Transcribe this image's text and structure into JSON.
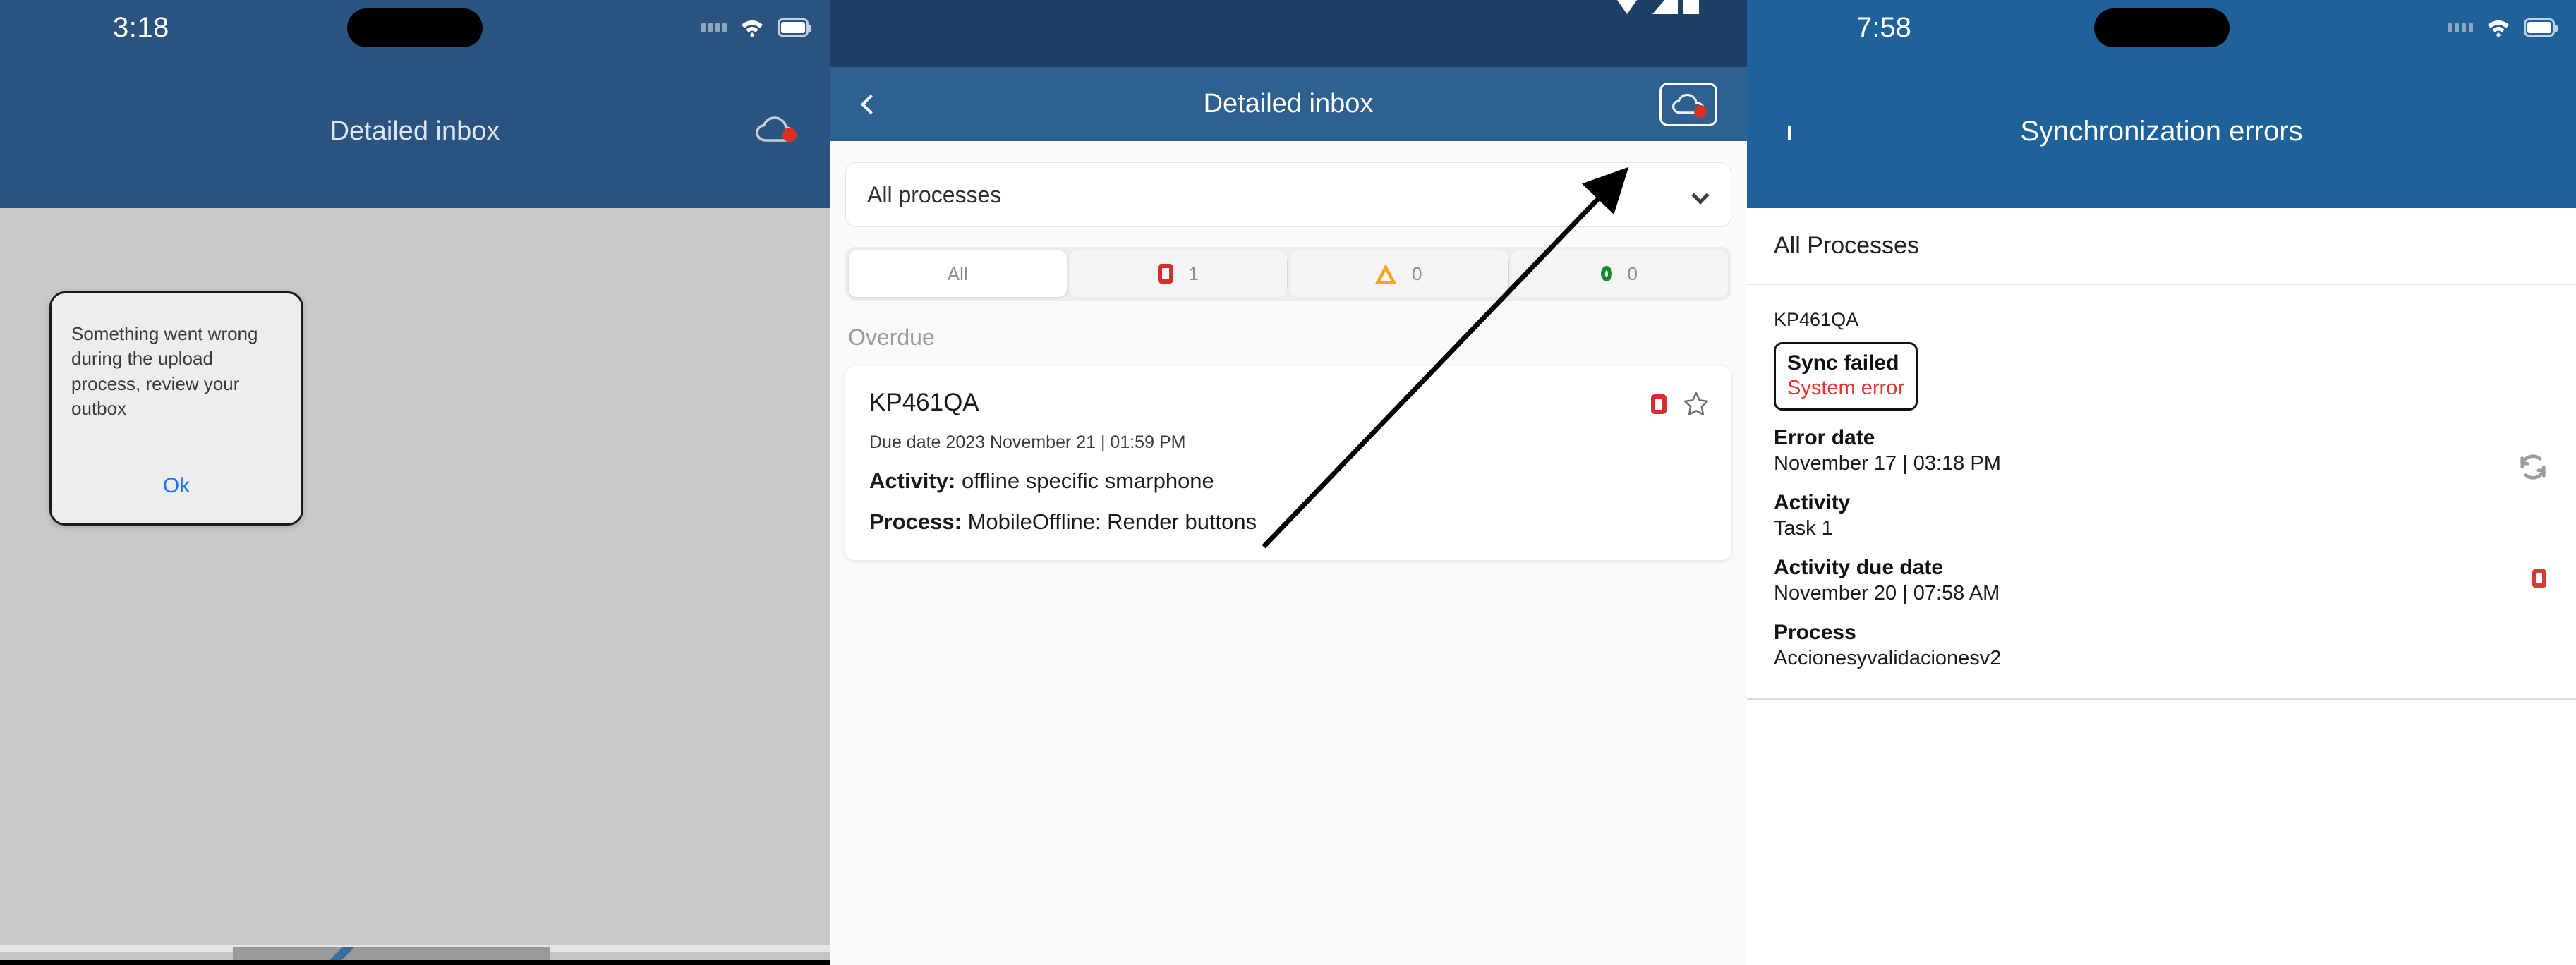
{
  "panel1": {
    "status_bar": {
      "time": "3:18",
      "icons": [
        "dots-icon",
        "wifi-icon",
        "battery-icon"
      ]
    },
    "title": "Detailed inbox",
    "cloud_button": {
      "icon": "cloud-icon",
      "badge_color": "#d93025"
    },
    "dialog": {
      "message": "Something went wrong during the upload process, review your outbox",
      "ok_label": "Ok",
      "ok_color": "#1f6fef"
    }
  },
  "panel2": {
    "status_bar": {
      "icons": [
        "triangle-down-icon",
        "signal-icon",
        "battery-icon"
      ]
    },
    "title": "Detailed inbox",
    "back_label": "",
    "cloud_button": {
      "icon": "cloud-icon",
      "badge_color": "#d93025",
      "highlighted": true
    },
    "process_select": {
      "value": "All processes",
      "chevron": "chevron-down-icon"
    },
    "segments": [
      {
        "label": "All",
        "icon": "",
        "count": "",
        "active": true
      },
      {
        "label": "",
        "icon": "square-red-icon",
        "count": "1",
        "active": false
      },
      {
        "label": "",
        "icon": "triangle-amber-icon",
        "count": "0",
        "active": false
      },
      {
        "label": "",
        "icon": "circle-green-icon",
        "count": "0",
        "active": false
      }
    ],
    "section_label": "Overdue",
    "card": {
      "title": "KP461QA",
      "due_date": "Due date 2023 November 21 | 01:59 PM",
      "activity_label": "Activity:",
      "activity_value": "offline specific smarphone",
      "process_label": "Process:",
      "process_value": "MobileOffline: Render buttons",
      "status_icon": "square-red-icon",
      "favorite_icon": "star-outline-icon"
    }
  },
  "panel3": {
    "status_bar": {
      "time": "7:58",
      "icons": [
        "dots-icon",
        "wifi-icon",
        "battery-icon"
      ]
    },
    "title": "Synchronization errors",
    "list_header": "All Processes",
    "item": {
      "id": "KP461QA",
      "badge_title": "Sync failed",
      "badge_subtitle": "System error",
      "badge_subtitle_color": "#e8342f",
      "fields": [
        {
          "label": "Error date",
          "value": "November 17 | 03:18 PM"
        },
        {
          "label": "Activity",
          "value": "Task 1"
        },
        {
          "label": "Activity due date",
          "value": "November 20 | 07:58 AM"
        },
        {
          "label": "Process",
          "value": "Accionesyvalidacionesv2"
        }
      ],
      "sync_icon": "refresh-icon",
      "status_icon": "square-red-icon"
    }
  },
  "annotation": {
    "arrow": "arrow-pointing-to-cloud-button"
  }
}
